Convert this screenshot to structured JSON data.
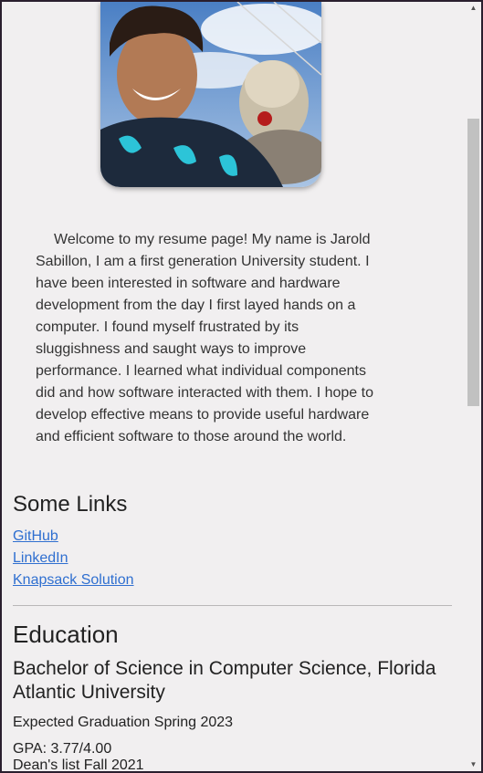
{
  "profile": {
    "intro": "Welcome to my resume page! My name is Jarold Sabillon, I am a first generation University student. I have been interested in software and hardware development from the day I first layed hands on a computer. I found myself frustrated by its sluggishness and saught ways to improve performance. I learned what individual components did and how software interacted with them. I hope to develop effective means to provide useful hardware and efficient software to those around the world."
  },
  "links": {
    "title": "Some Links",
    "items": [
      {
        "label": "GitHub"
      },
      {
        "label": "LinkedIn"
      },
      {
        "label": "Knapsack Solution"
      }
    ]
  },
  "education": {
    "title": "Education",
    "degree": "Bachelor of Science in Computer Science, Florida Atlantic University",
    "graduation": "Expected Graduation Spring 2023",
    "gpa": "GPA: 3.77/4.00",
    "honor": "Dean's list Fall 2021"
  },
  "colors": {
    "page_bg": "#f1eff0",
    "link": "#2f6fd0",
    "text": "#222222"
  },
  "icons": {
    "scroll_up": "triangle-up-icon",
    "scroll_down": "triangle-down-icon"
  }
}
